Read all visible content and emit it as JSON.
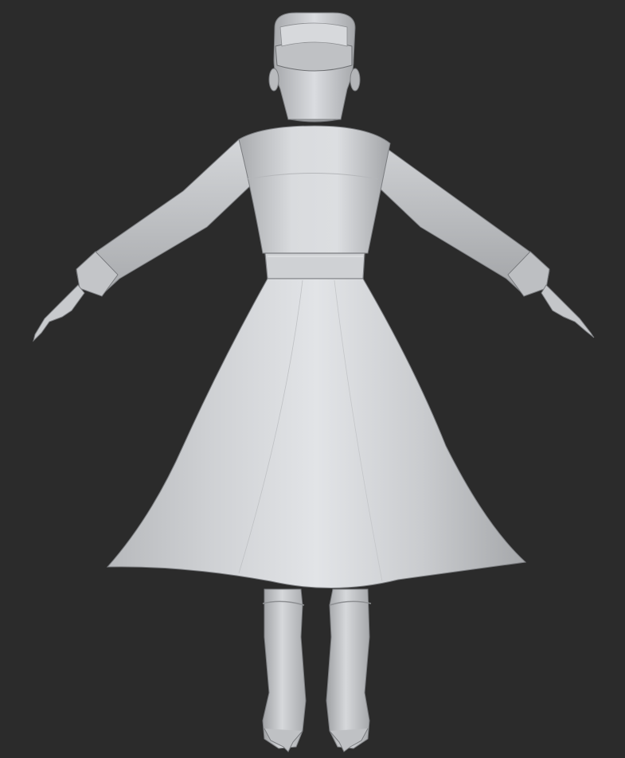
{
  "scene": {
    "background_color": "#2b2b2b",
    "model_color": "#c9cbce",
    "model_highlight": "#dfe1e4",
    "model_shadow": "#8f9194",
    "outline_color": "#6e7073"
  },
  "icons": {
    "figure": "mannequin-figure-icon"
  }
}
